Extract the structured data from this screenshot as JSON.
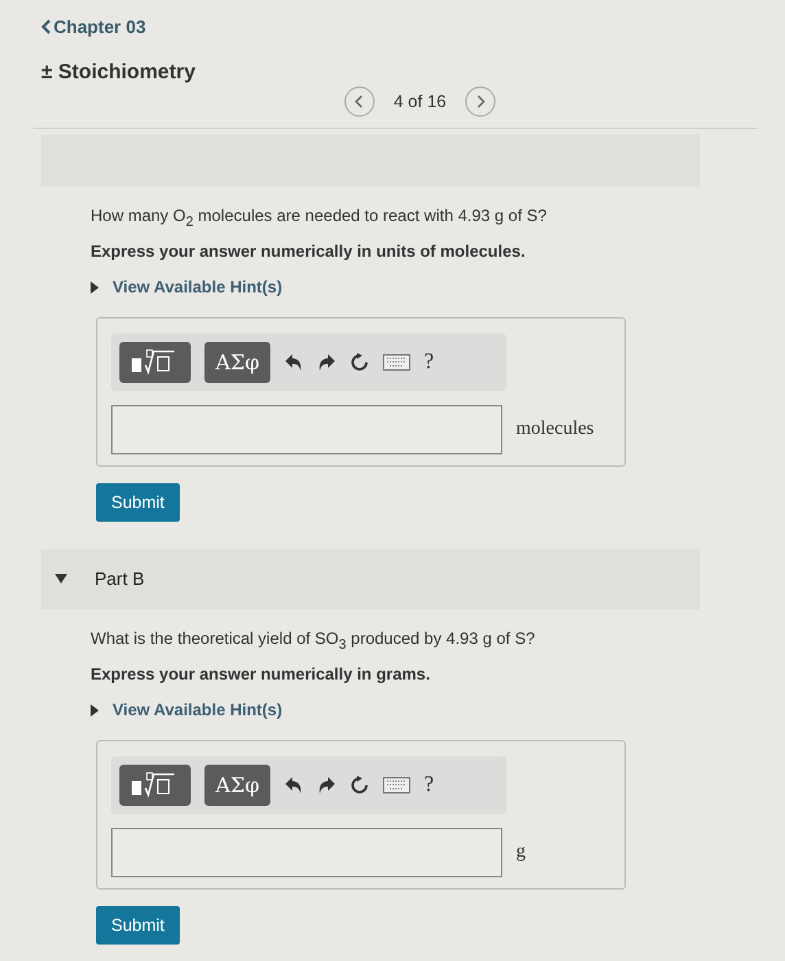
{
  "header": {
    "back_link": "Chapter 03",
    "title": "± Stoichiometry"
  },
  "pager": {
    "position": "4 of 16"
  },
  "parts": [
    {
      "question": "How many O$_{2}$ molecules are needed to react with 4.93 g of S?",
      "instruction": "Express your answer numerically in units of molecules.",
      "hint_link": "View Available Hint(s)",
      "toolbar": {
        "symbols_button": "ΑΣφ",
        "help_button": "?"
      },
      "unit": "molecules",
      "submit": "Submit"
    },
    {
      "label": "Part B",
      "expanded": true,
      "question": "What is the theoretical yield of SO$_{3}$ produced by 4.93 g of S?",
      "instruction": "Express your answer numerically in grams.",
      "hint_link": "View Available Hint(s)",
      "toolbar": {
        "symbols_button": "ΑΣφ",
        "help_button": "?"
      },
      "unit": "g",
      "submit": "Submit"
    }
  ]
}
